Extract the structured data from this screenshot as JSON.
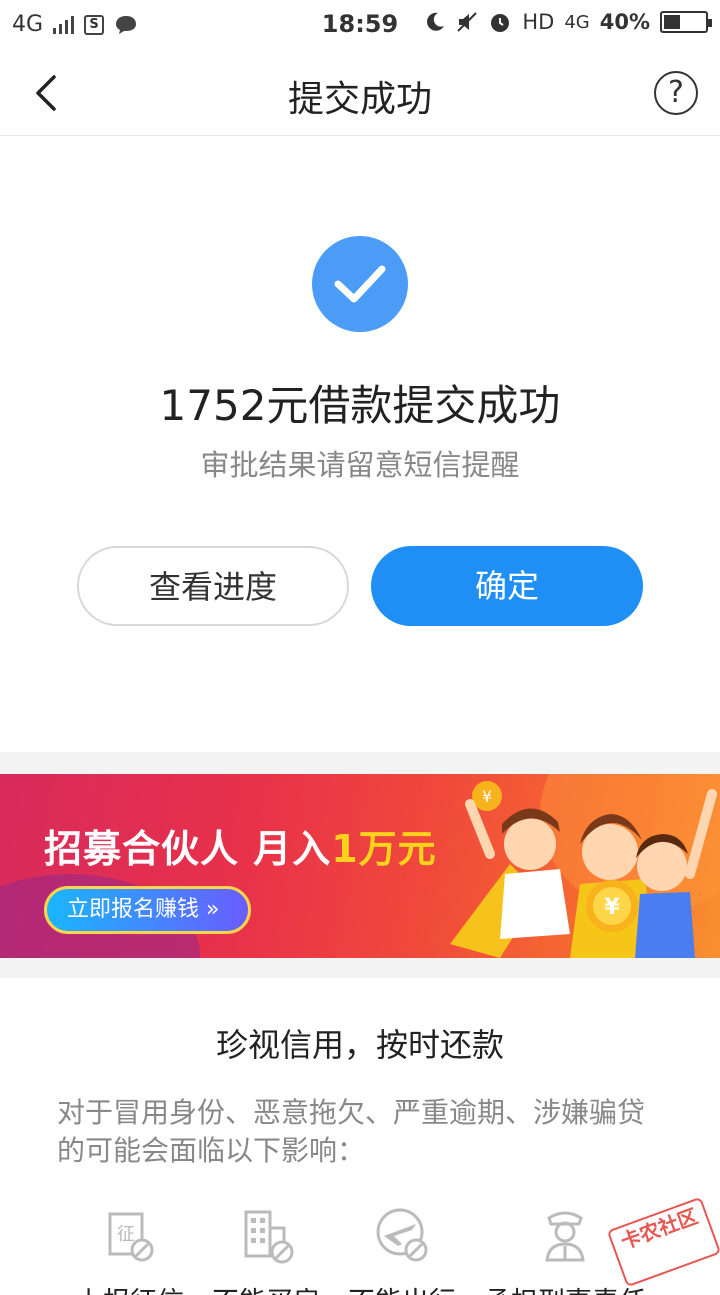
{
  "status_bar": {
    "network": "4G",
    "time": "18:59",
    "hd": "HD",
    "network_right": "4G",
    "battery": "40%",
    "battery_level": 0.4
  },
  "header": {
    "title": "提交成功"
  },
  "success": {
    "title": "1752元借款提交成功",
    "subtitle": "审批结果请留意短信提醒"
  },
  "buttons": {
    "progress": "查看进度",
    "confirm": "确定"
  },
  "banner": {
    "headline_prefix": "招募合伙人 月入",
    "headline_highlight": "1万元",
    "cta": "立即报名赚钱 »"
  },
  "credit": {
    "title": "珍视信用，按时还款",
    "description": "对于冒用身份、恶意拖欠、严重逾期、涉嫌骗贷的可能会面临以下影响：",
    "items": [
      {
        "label": "上报征信",
        "icon": "credit-report-icon",
        "glyph": "征"
      },
      {
        "label": "不能买房",
        "icon": "building-icon"
      },
      {
        "label": "不能出行",
        "icon": "plane-icon"
      },
      {
        "label": "承担刑事责任",
        "icon": "police-icon"
      }
    ]
  },
  "watermark": {
    "text": "卡农社区"
  },
  "colors": {
    "primary": "#1f8ef5",
    "check_circle": "#4a9cf6",
    "subtitle_gray": "#888888"
  }
}
